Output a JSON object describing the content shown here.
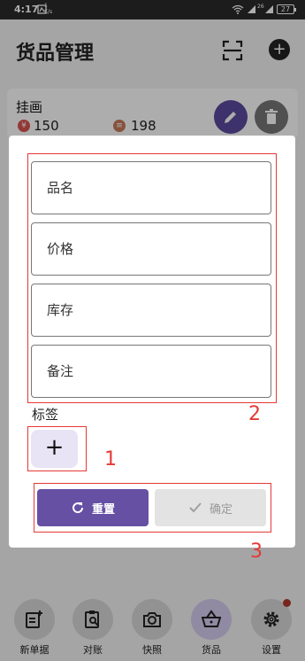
{
  "status_bar": {
    "time": "4:17",
    "speed_value": "1",
    "speed_unit": "K/s",
    "network_label": "26",
    "battery": "27"
  },
  "app_bar": {
    "title": "货品管理",
    "scan_icon": "scan-icon",
    "add_icon": "plus-circle-icon"
  },
  "item": {
    "name": "挂画",
    "price": "150",
    "stock": "198",
    "price_icon": "yen-coin-icon",
    "stock_icon": "stock-icon"
  },
  "dialog": {
    "fields": [
      {
        "placeholder": "品名",
        "value": ""
      },
      {
        "placeholder": "价格",
        "value": ""
      },
      {
        "placeholder": "库存",
        "value": ""
      },
      {
        "placeholder": "备注",
        "value": ""
      }
    ],
    "tags_label": "标签",
    "add_tag": "+",
    "reset_label": "重置",
    "confirm_label": "确定"
  },
  "annotations": [
    "1",
    "2",
    "3"
  ],
  "bottom_nav": [
    {
      "label": "新单据",
      "icon": "new-document-icon"
    },
    {
      "label": "对账",
      "icon": "reconcile-icon"
    },
    {
      "label": "快照",
      "icon": "camera-icon"
    },
    {
      "label": "货品",
      "icon": "basket-icon",
      "active": true
    },
    {
      "label": "设置",
      "icon": "gear-icon",
      "badge": true
    }
  ],
  "colors": {
    "primary": "#6650a4",
    "annotation": "#e53935",
    "active_nav": "#d5cdef"
  }
}
